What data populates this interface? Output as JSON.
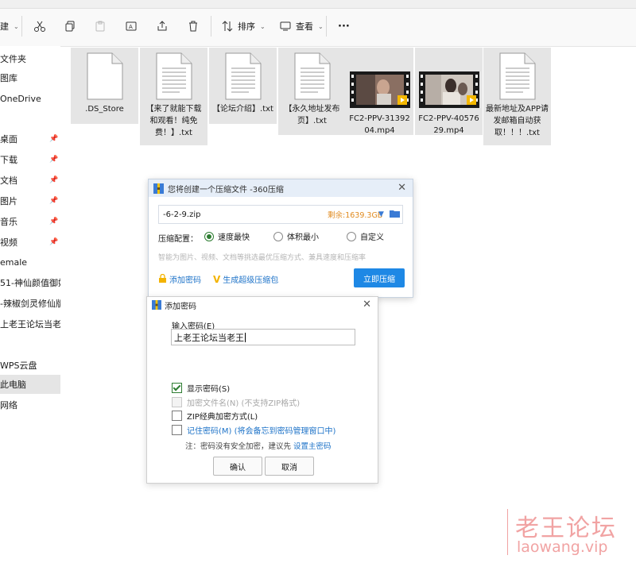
{
  "toolbar": {
    "new_label": "建",
    "sort_label": "排序",
    "view_label": "查看",
    "more_label": "···"
  },
  "sidebar": {
    "items": [
      {
        "label": "文件夹"
      },
      {
        "label": "图库"
      },
      {
        "label": "OneDrive"
      },
      {
        "label": "桌面"
      },
      {
        "label": "下载"
      },
      {
        "label": "文档"
      },
      {
        "label": "图片"
      },
      {
        "label": "音乐"
      },
      {
        "label": "视频"
      },
      {
        "label": "emale"
      },
      {
        "label": "51-神仙颜值御姐"
      },
      {
        "label": "-辣椒剑灵修仙版"
      },
      {
        "label": "上老王论坛当老王"
      },
      {
        "label": "WPS云盘"
      },
      {
        "label": "此电脑"
      },
      {
        "label": "网络"
      }
    ]
  },
  "files": [
    {
      "name": ".DS_Store",
      "type": "doc"
    },
    {
      "name": "【来了就能下载和观看！纯免费！】.txt",
      "type": "doc"
    },
    {
      "name": "【论坛介绍】.txt",
      "type": "doc"
    },
    {
      "name": "【永久地址发布页】.txt",
      "type": "doc"
    },
    {
      "name": "FC2-PPV-3139204.mp4",
      "type": "video"
    },
    {
      "name": "FC2-PPV-4057629.mp4",
      "type": "video"
    },
    {
      "name": "最新地址及APP请发邮箱自动获取！！！.txt",
      "type": "doc"
    }
  ],
  "compress_dialog": {
    "title": "您将创建一个压缩文件 -360压缩",
    "filename": "-6-2-9.zip",
    "free_space": "剩余:1639.3GB",
    "config_label": "压缩配置：",
    "option_fast": "速度最快",
    "option_small": "体积最小",
    "option_custom": "自定义",
    "hint": "智能为图片、视频、文档等挑选最优压缩方式、兼具速度和压缩率",
    "add_password": "添加密码",
    "super_pack": "生成超级压缩包",
    "compress_now": "立即压缩"
  },
  "password_dialog": {
    "title": "添加密码",
    "input_label": "输入密码(E)",
    "password_value": "上老王论坛当老王",
    "show_password": "显示密码(S)",
    "encrypt_filename": "加密文件名(N) (不支持ZIP格式)",
    "zip_classic": "ZIP经典加密方式(L)",
    "remember": "记住密码(M) (将会备忘到密码管理窗口中)",
    "note_prefix": "注：密码没有安全加密，建议先",
    "note_link": "设置主密码",
    "ok": "确认",
    "cancel": "取消"
  },
  "watermark": {
    "cn": "老王论坛",
    "en": "laowang.vip"
  },
  "colors": {
    "accent_blue": "#1e88e5",
    "check_green": "#2e7d32",
    "free_space_orange": "#e08a1e",
    "link_blue": "#1e73c8",
    "watermark": "#f1a3a3"
  }
}
